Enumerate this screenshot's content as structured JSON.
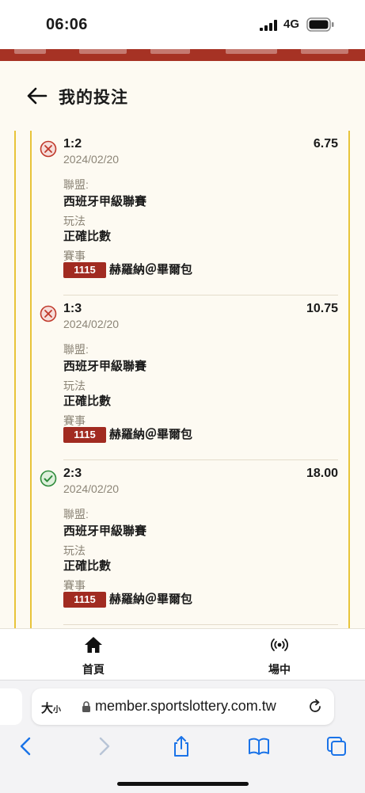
{
  "status_bar": {
    "time": "06:06",
    "network": "4G"
  },
  "header": {
    "title": "我的投注"
  },
  "bets": [
    {
      "result": "lost",
      "score": "1:2",
      "odds": "6.75",
      "date": "2024/02/20",
      "league_label": "聯盟:",
      "league": "西班牙甲級聯賽",
      "play_label": "玩法",
      "play": "正確比數",
      "match_label": "賽事",
      "match_no": "1115",
      "match": "赫羅納＠畢爾包"
    },
    {
      "result": "lost",
      "score": "1:3",
      "odds": "10.75",
      "date": "2024/02/20",
      "league_label": "聯盟:",
      "league": "西班牙甲級聯賽",
      "play_label": "玩法",
      "play": "正確比數",
      "match_label": "賽事",
      "match_no": "1115",
      "match": "赫羅納＠畢爾包"
    },
    {
      "result": "won",
      "score": "2:3",
      "odds": "18.00",
      "date": "2024/02/20",
      "league_label": "聯盟:",
      "league": "西班牙甲級聯賽",
      "play_label": "玩法",
      "play": "正確比數",
      "match_label": "賽事",
      "match_no": "1115",
      "match": "赫羅納＠畢爾包"
    }
  ],
  "tabbar": {
    "home_label": "首頁",
    "live_label": "場中"
  },
  "browser": {
    "text_size_label": "大",
    "text_size_small": "小",
    "url": "member.sportslottery.com.tw"
  },
  "colors": {
    "accent_red": "#a12b21",
    "gold": "#e8c43a",
    "win_green": "#2e8b3a",
    "loss_red": "#c0392b"
  },
  "icons": {
    "lost": "circle-x-icon",
    "won": "circle-check-icon",
    "back": "arrow-left-icon",
    "home": "home-icon",
    "live": "broadcast-icon",
    "lock": "lock-icon",
    "reload": "reload-icon",
    "browser_back": "chevron-left-icon",
    "browser_forward": "chevron-right-icon",
    "share": "share-icon",
    "bookmarks": "book-icon",
    "tabs": "tabs-icon"
  }
}
